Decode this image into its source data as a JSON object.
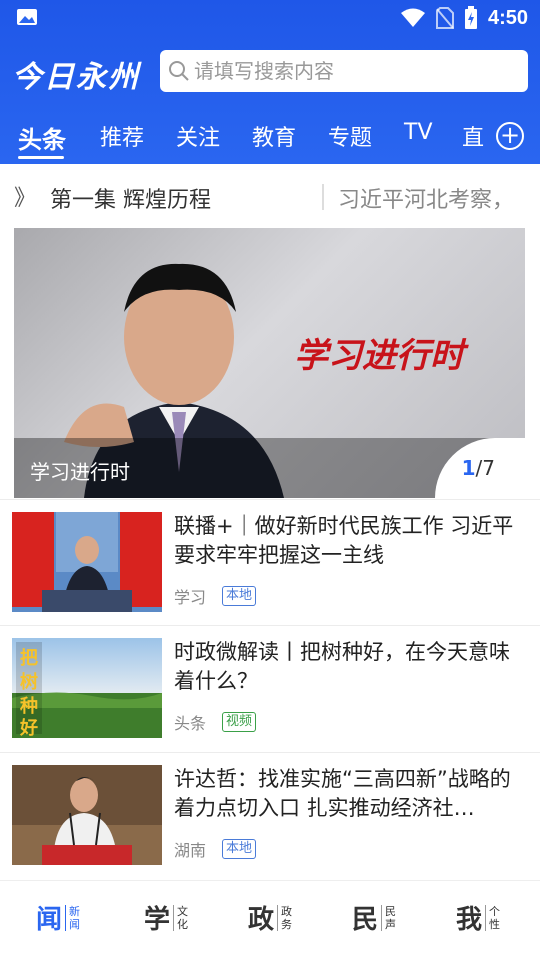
{
  "status_bar": {
    "time": "4:50",
    "icons": [
      "image-icon",
      "wifi-icon",
      "no-sim-icon",
      "battery-charging-icon"
    ]
  },
  "header": {
    "logo_text": "今日永州",
    "search_placeholder": "请填写搜索内容",
    "tabs": [
      "头条",
      "推荐",
      "关注",
      "教育",
      "专题",
      "TV",
      "直"
    ],
    "active_tab": "头条",
    "accent_color": "#2a66f0"
  },
  "ticker": {
    "arrow": "》",
    "item1": "第一集 辉煌历程",
    "item2": "习近平河北考察，"
  },
  "banner": {
    "slogan": "学习进行时",
    "caption": "学习进行时",
    "page_current": "1",
    "page_total": "/7"
  },
  "news": [
    {
      "title": "联播+｜做好新时代民族工作 习近平要求牢牢把握这一主线",
      "source": "学习",
      "tag": "本地",
      "tag_color": "#4a7bd8",
      "thumb": "flags-podium"
    },
    {
      "title": "时政微解读丨把树种好，在今天意味着什么？",
      "source": "头条",
      "tag": "视频",
      "tag_color": "#3aa048",
      "thumb": "field-trees",
      "thumb_text": "把树种好"
    },
    {
      "title": "许达哲：找准实施“三高四新”战略的着力点切入口 扎实推动经济社…",
      "source": "湖南",
      "tag": "本地",
      "tag_color": "#4a7bd8",
      "thumb": "speaker-podium"
    }
  ],
  "bottom_nav": [
    {
      "big": "闻",
      "small1": "新",
      "small2": "闻",
      "active": true
    },
    {
      "big": "学",
      "small1": "文",
      "small2": "化",
      "active": false
    },
    {
      "big": "政",
      "small1": "政",
      "small2": "务",
      "active": false
    },
    {
      "big": "民",
      "small1": "民",
      "small2": "声",
      "active": false
    },
    {
      "big": "我",
      "small1": "个",
      "small2": "性",
      "active": false
    }
  ]
}
